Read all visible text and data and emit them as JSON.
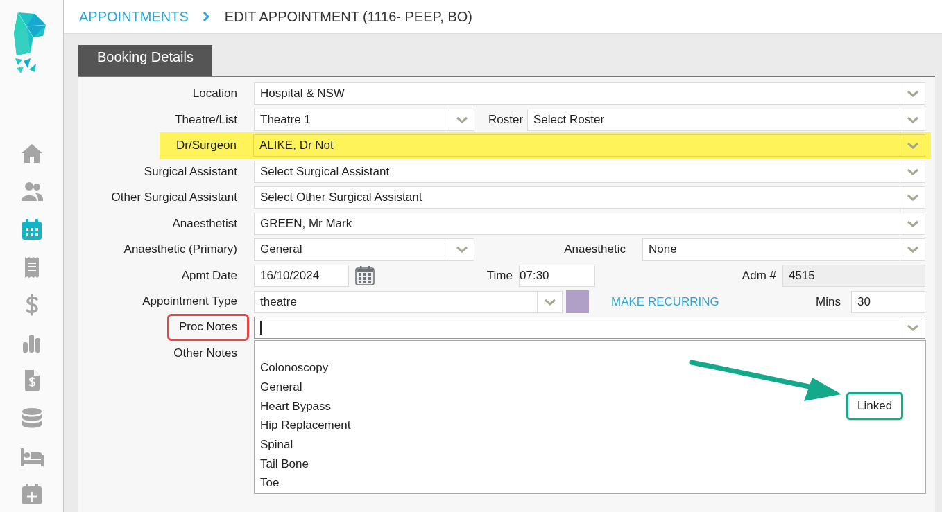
{
  "sidebar": {
    "nav": [
      {
        "selected": false
      },
      {
        "selected": false
      },
      {
        "selected": true
      },
      {
        "selected": false
      },
      {
        "selected": false
      },
      {
        "selected": false
      },
      {
        "selected": false
      },
      {
        "selected": false
      },
      {
        "selected": false
      },
      {
        "selected": false
      }
    ]
  },
  "breadcrumb": {
    "parent": "APPOINTMENTS",
    "current": "EDIT APPOINTMENT (1116- PEEP, BO)"
  },
  "tabs": [
    {
      "label": "Booking Details",
      "selected": true
    }
  ],
  "form": {
    "rows": [
      {
        "label": "Location",
        "highlighted": false,
        "outlined": false,
        "fields": [
          {
            "kind": "select",
            "value": "Hospital & NSW"
          }
        ]
      },
      {
        "label": "Theatre/List",
        "highlighted": false,
        "outlined": false,
        "fields": [
          {
            "kind": "select",
            "value": "Theatre 1"
          },
          {
            "kind": "label",
            "text": "Roster"
          },
          {
            "kind": "select",
            "value": "Select Roster"
          }
        ]
      },
      {
        "label": "Dr/Surgeon",
        "highlighted": true,
        "outlined": false,
        "fields": [
          {
            "kind": "select",
            "value": "ALIKE, Dr Not"
          }
        ]
      },
      {
        "label": "Surgical Assistant",
        "highlighted": false,
        "outlined": false,
        "fields": [
          {
            "kind": "select",
            "value": "Select Surgical Assistant"
          }
        ]
      },
      {
        "label": "Other Surgical Assistant",
        "highlighted": false,
        "outlined": false,
        "fields": [
          {
            "kind": "select",
            "value": "Select Other Surgical Assistant"
          }
        ]
      },
      {
        "label": "Anaesthetist",
        "highlighted": false,
        "outlined": false,
        "fields": [
          {
            "kind": "select",
            "value": "GREEN, Mr Mark"
          }
        ]
      },
      {
        "label": "Anaesthetic (Primary)",
        "highlighted": false,
        "outlined": false,
        "fields": [
          {
            "kind": "select",
            "value": "General"
          },
          {
            "kind": "label",
            "text": "Anaesthetic"
          },
          {
            "kind": "select",
            "value": "None"
          }
        ]
      },
      {
        "label": "Apmt Date",
        "highlighted": false,
        "outlined": false,
        "fields": [
          {
            "kind": "input",
            "value": "16/10/2024"
          },
          {
            "kind": "calendar"
          },
          {
            "kind": "label",
            "text": "Time"
          },
          {
            "kind": "input",
            "value": "07:30"
          },
          {
            "kind": "label",
            "text": "Adm #"
          },
          {
            "kind": "readonly",
            "value": "4515"
          }
        ]
      },
      {
        "label": "Appointment Type",
        "highlighted": false,
        "outlined": false,
        "fields": [
          {
            "kind": "select",
            "value": "theatre"
          },
          {
            "kind": "swatch",
            "color": "#b0a0c8"
          },
          {
            "kind": "link",
            "text": "MAKE RECURRING"
          },
          {
            "kind": "label",
            "text": "Mins"
          },
          {
            "kind": "input",
            "value": "30"
          }
        ]
      },
      {
        "label": "Proc Notes",
        "highlighted": false,
        "outlined": true,
        "fields": [
          {
            "kind": "combo",
            "focused": true,
            "expanded": true,
            "options": [
              {
                "label": "Colonoscopy"
              },
              {
                "label": "General"
              },
              {
                "label": "Heart Bypass",
                "tag": "Linked",
                "tag_outlined": true
              },
              {
                "label": "Hip Replacement"
              },
              {
                "label": "Spinal"
              },
              {
                "label": "Tail Bone"
              },
              {
                "label": "Toe"
              }
            ]
          }
        ]
      },
      {
        "label": "Other Notes",
        "highlighted": false,
        "outlined": false
      }
    ]
  }
}
